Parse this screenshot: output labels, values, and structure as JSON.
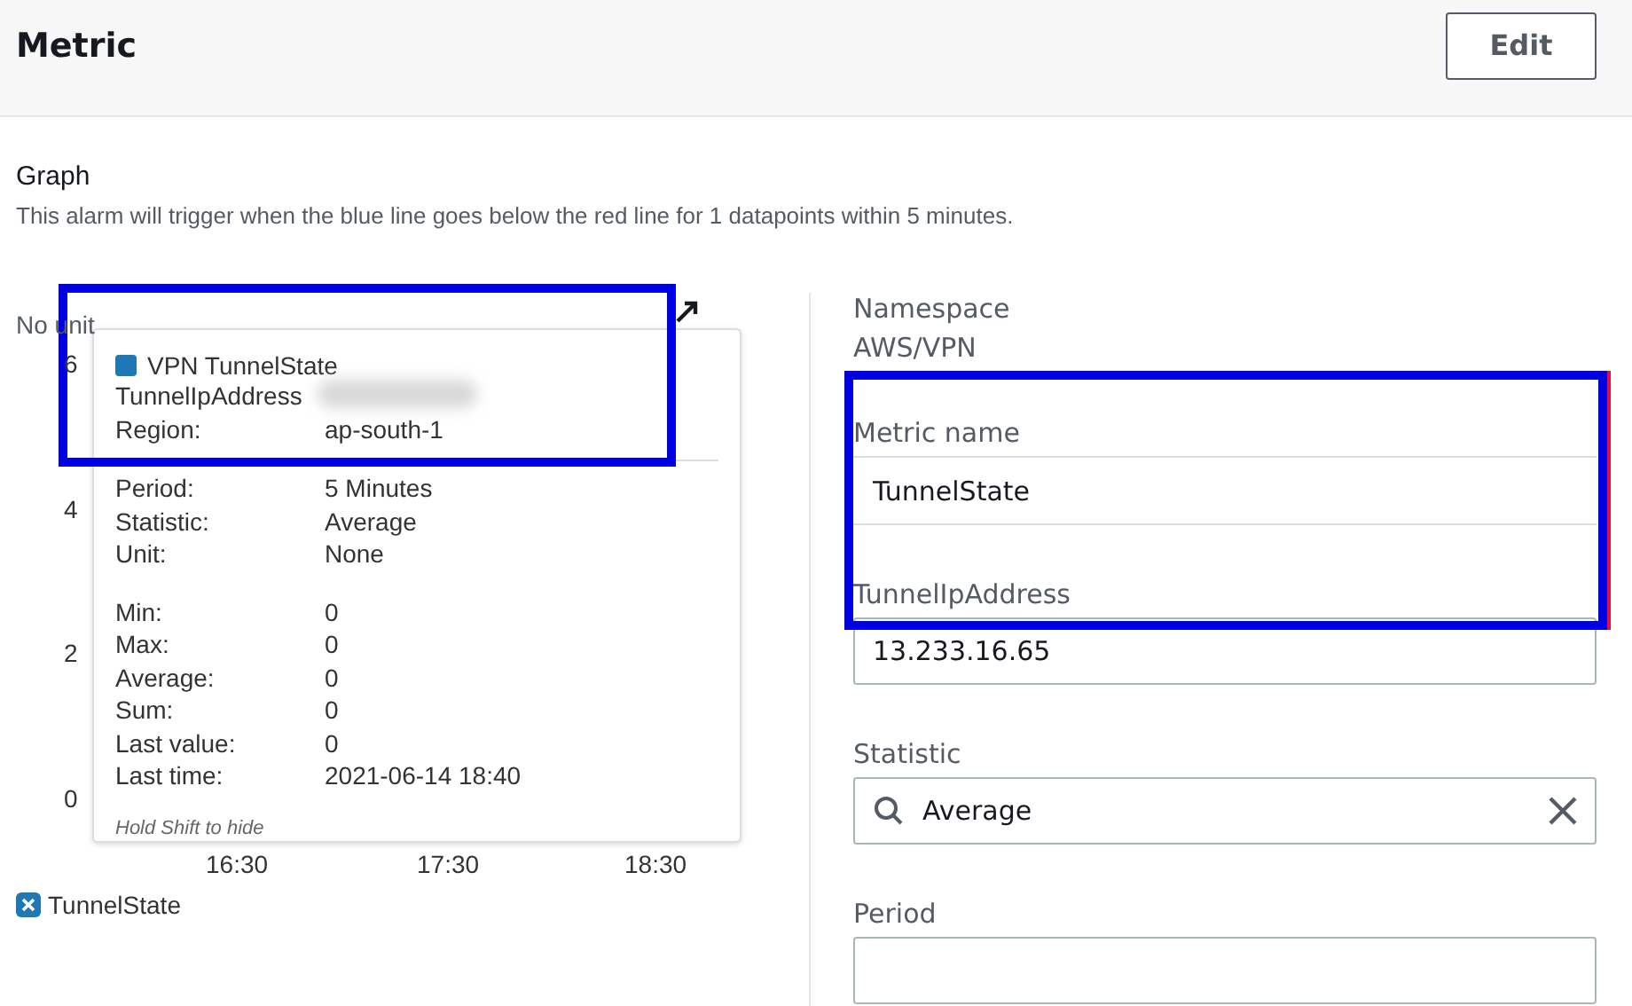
{
  "header": {
    "title": "Metric",
    "edit_button": "Edit"
  },
  "graph": {
    "title": "Graph",
    "description": "This alarm will trigger when the blue line goes below the red line for 1 datapoints within 5 minutes.",
    "unit_label": "No unit",
    "y_ticks": [
      "6",
      "4",
      "2",
      "0"
    ],
    "x_ticks": [
      "16:30",
      "17:30",
      "18:30"
    ],
    "tooltip": {
      "series": "VPN TunnelState",
      "groups": [
        [
          {
            "kind": "blurred",
            "label": "TunnelIpAddress"
          },
          {
            "kind": "text",
            "label": "Region:",
            "value": "ap-south-1"
          }
        ],
        [
          {
            "kind": "text",
            "label": "Period:",
            "value": "5 Minutes"
          },
          {
            "kind": "text",
            "label": "Statistic:",
            "value": "Average"
          },
          {
            "kind": "text",
            "label": "Unit:",
            "value": "None"
          }
        ],
        [
          {
            "kind": "text",
            "label": "Min:",
            "value": "0"
          },
          {
            "kind": "text",
            "label": "Max:",
            "value": "0"
          },
          {
            "kind": "text",
            "label": "Average:",
            "value": "0"
          },
          {
            "kind": "text",
            "label": "Sum:",
            "value": "0"
          },
          {
            "kind": "text",
            "label": "Last value:",
            "value": "0"
          },
          {
            "kind": "text",
            "label": "Last time:",
            "value": "2021-06-14 18:40"
          }
        ]
      ],
      "hint": "Hold Shift to hide"
    },
    "legend": [
      {
        "label": "TunnelState"
      }
    ]
  },
  "details": [
    {
      "kind": "text",
      "label": "Namespace",
      "value": "AWS/VPN"
    },
    {
      "kind": "plain",
      "label": "Metric name",
      "value": "TunnelState"
    },
    {
      "kind": "input",
      "label": "TunnelIpAddress",
      "value": "13.233.16.65"
    },
    {
      "kind": "search",
      "label": "Statistic",
      "value": "Average"
    },
    {
      "kind": "input",
      "label": "Period"
    }
  ],
  "highlights": [
    {
      "kind": "box"
    },
    {
      "kind": "box"
    }
  ]
}
